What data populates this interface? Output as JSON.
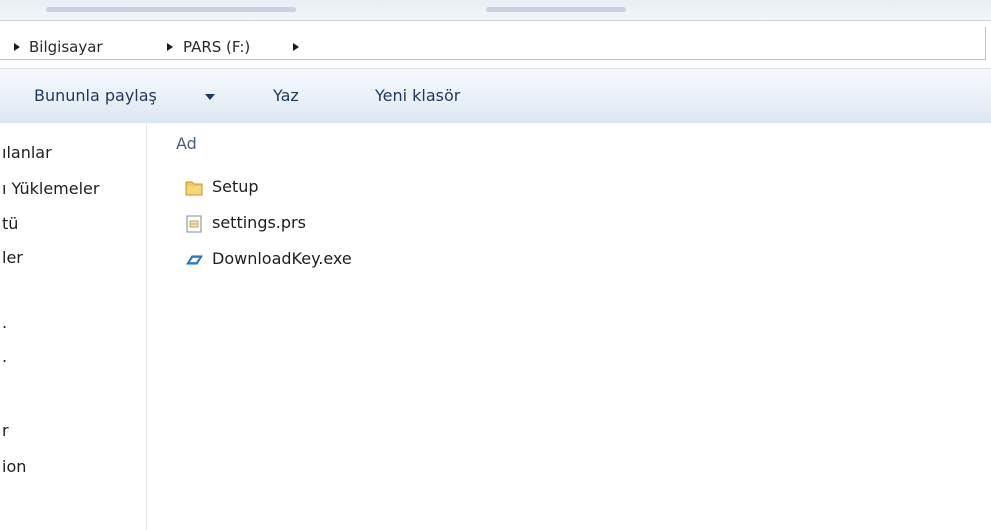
{
  "address": {
    "crumbs": [
      {
        "label": "Bilgisayar"
      },
      {
        "label": "PARS (F:)"
      }
    ]
  },
  "toolbar": {
    "share_label": "Bununla paylaş",
    "burn_label": "Yaz",
    "new_folder_label": "Yeni klasör"
  },
  "nav": {
    "items": [
      "ılanlar",
      "ı Yüklemeler",
      "tü",
      "ler",
      ".",
      ".",
      "r",
      "ion"
    ]
  },
  "file_list": {
    "column_name": "Ad",
    "files": [
      {
        "name": "Setup",
        "icon": "folder-icon"
      },
      {
        "name": "settings.prs",
        "icon": "document-icon"
      },
      {
        "name": "DownloadKey.exe",
        "icon": "application-icon"
      }
    ]
  },
  "colors": {
    "command_text": "#1e395b",
    "folder": "#e8b84a",
    "border": "#b7c3d2"
  }
}
